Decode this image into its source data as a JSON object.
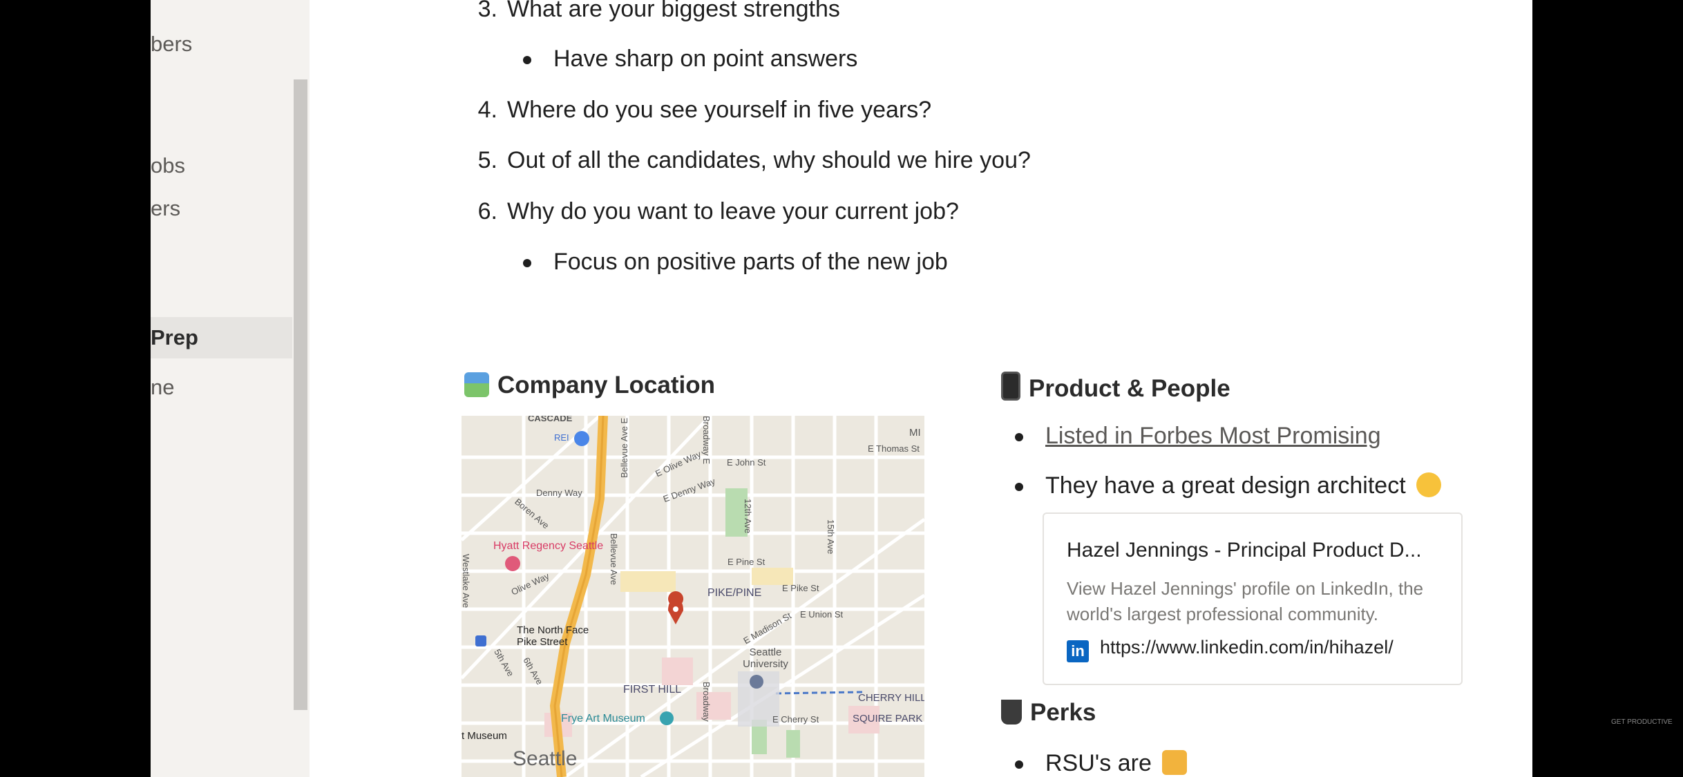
{
  "sidebar": {
    "items": [
      {
        "label": "bers"
      },
      {
        "label": "obs"
      },
      {
        "label": "ers"
      },
      {
        "label": "Prep"
      },
      {
        "label": "ne"
      }
    ]
  },
  "questions": [
    {
      "num": "3.",
      "text": "What are your biggest strengths"
    },
    {
      "num": "4.",
      "text": "Where do you see yourself in five years?"
    },
    {
      "num": "5.",
      "text": "Out of all the candidates, why should we hire you?"
    },
    {
      "num": "6.",
      "text": "Why do you want to leave your current job?"
    }
  ],
  "bullets": [
    "Have sharp on point answers",
    "Focus on positive parts of the new job"
  ],
  "company_location": {
    "title": "Company Location",
    "icon": "map-emoji-icon",
    "map_labels": {
      "cascade": "CASCADE",
      "rei": "REI",
      "denny": "Denny Way",
      "olive": "E Olive Way",
      "john": "E John St",
      "thomas": "E Thomas St",
      "edenny": "E Denny Way",
      "boren": "Boren Ave",
      "bellevue": "Bellevue Ave E",
      "bellevue2": "Bellevue Ave",
      "broadway": "Broadway E",
      "twelfth": "12th Ave",
      "fifteenth": "15th Ave",
      "hyatt": "Hyatt Regency Seattle",
      "olive2": "Olive Way",
      "westlake": "Westlake Ave",
      "epine": "E Pine St",
      "pikepine": "PIKE/PINE",
      "epike": "E Pike St",
      "eunion": "E Union St",
      "madison": "E Madison St",
      "northface": "The North Face Pike Street",
      "seattleu": "Seattle University",
      "fifth": "5th Ave",
      "sixth": "6th Ave",
      "firsthill": "FIRST HILL",
      "broadway2": "Broadway",
      "cherryhill": "CHERRY HILL",
      "frye": "Frye Art Museum",
      "echerry": "E Cherry St",
      "squire": "SQUIRE PARK",
      "museum": "t Museum",
      "seattle": "Seattle",
      "mi": "MI"
    }
  },
  "product_people": {
    "title": "Product & People",
    "icon": "phone-emoji-icon",
    "bullets": [
      {
        "text": "Listed in Forbes Most Promising",
        "link": true
      },
      {
        "text": "They have a great design architect",
        "emoji": "star-struck-emoji-icon"
      }
    ],
    "card": {
      "title": "Hazel Jennings - Principal Product D...",
      "description": "View Hazel Jennings' profile on LinkedIn, the world's largest professional community.",
      "url": "https://www.linkedin.com/in/hihazel/",
      "icon_letters": "in"
    }
  },
  "perks": {
    "title": "Perks",
    "icon": "coffee-emoji-icon",
    "bullets": [
      {
        "text": "RSU's are",
        "emoji": "thumbs-up-emoji-icon"
      }
    ]
  },
  "colors": {
    "map_highway": "#f2b84b",
    "map_park": "#b9dcb0",
    "map_pin": "#c8442c",
    "linkedin": "#0a66c2"
  },
  "watermark": "GET PRODUCTIVE"
}
